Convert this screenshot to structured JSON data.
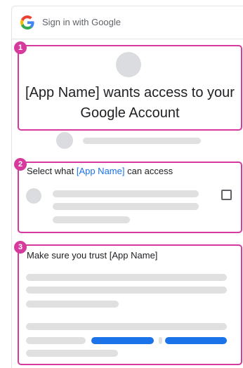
{
  "header": {
    "title": "Sign in with Google",
    "logo_icon": "google-g-icon"
  },
  "annotations": {
    "color": "#d63a9c",
    "badges": [
      "1",
      "2",
      "3"
    ]
  },
  "section1": {
    "title": "[App Name] wants access to your Google Account"
  },
  "section2": {
    "title_prefix": "Select what ",
    "title_app": "[App Name]",
    "title_suffix": " can access",
    "accent_color": "#1a73e8"
  },
  "section3": {
    "title": "Make sure you trust [App Name]"
  }
}
